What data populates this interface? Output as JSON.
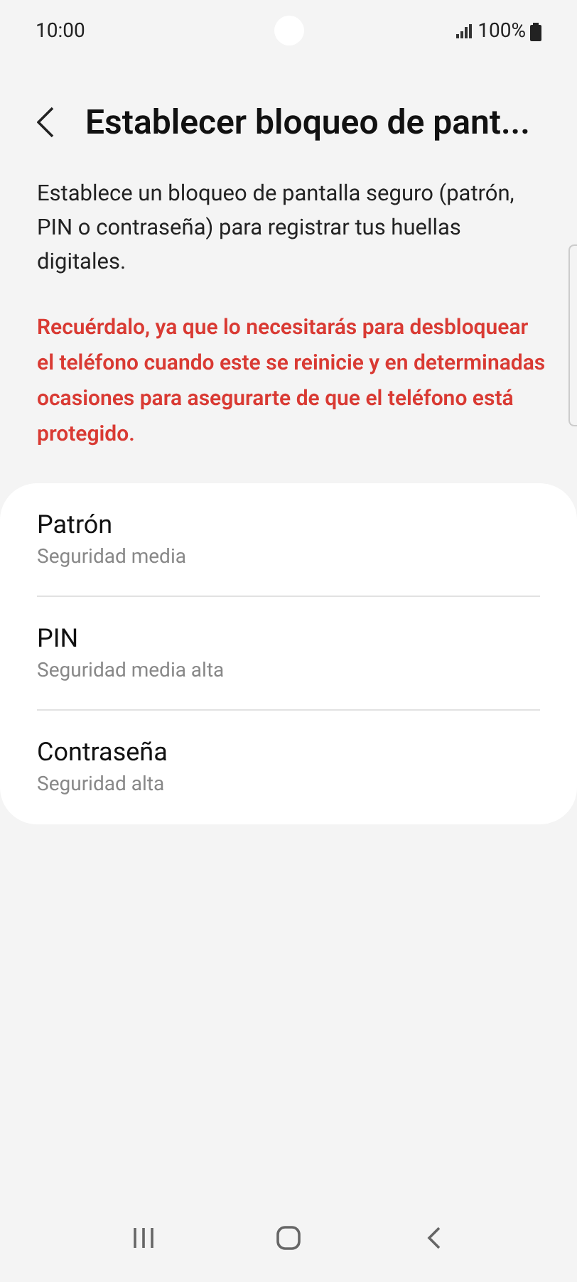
{
  "status_bar": {
    "time": "10:00",
    "battery": "100%"
  },
  "header": {
    "title": "Establecer bloqueo de pant..."
  },
  "description": "Establece un bloqueo de pantalla seguro (patrón, PIN o contraseña) para registrar tus huellas digitales.",
  "warning": "Recuérdalo, ya que lo necesitarás para desbloquear el teléfono cuando este se reinicie y en determinadas ocasiones para asegurarte de que el teléfono está protegido.",
  "options": [
    {
      "title": "Patrón",
      "subtitle": "Seguridad media"
    },
    {
      "title": "PIN",
      "subtitle": "Seguridad media alta"
    },
    {
      "title": "Contraseña",
      "subtitle": "Seguridad alta"
    }
  ]
}
